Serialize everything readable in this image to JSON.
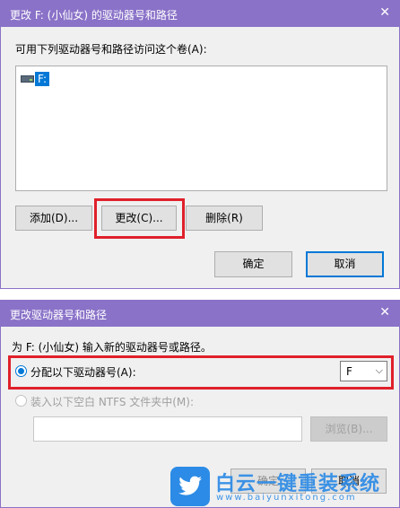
{
  "dialog1": {
    "title": "更改 F: (小仙女) 的驱动器号和路径",
    "close_glyph": "✕",
    "instruction": "可用下列驱动器号和路径访问这个卷(A):",
    "list_items": [
      {
        "label": "F:",
        "icon": "drive-icon"
      }
    ],
    "add_label": "添加(D)...",
    "change_label": "更改(C)...",
    "remove_label": "删除(R)",
    "ok_label": "确定",
    "cancel_label": "取消"
  },
  "dialog2": {
    "title": "更改驱动器号和路径",
    "close_glyph": "✕",
    "instruction": "为 F: (小仙女) 输入新的驱动器号或路径。",
    "assign_letter_label": "分配以下驱动器号(A):",
    "drive_letter_value": "F",
    "mount_folder_label": "装入以下空白 NTFS 文件夹中(M):",
    "folder_path_value": "",
    "browse_label": "浏览(B)...",
    "ok_label": "确定",
    "cancel_label": "取消"
  },
  "watermark": {
    "brand": "白云一键重装系统",
    "url": "www.baiyunxitong.com"
  },
  "colors": {
    "titlebar": "#8a72c8",
    "highlight": "#e0202a",
    "accent": "#0078d7",
    "watermark": "#2c8be6"
  }
}
